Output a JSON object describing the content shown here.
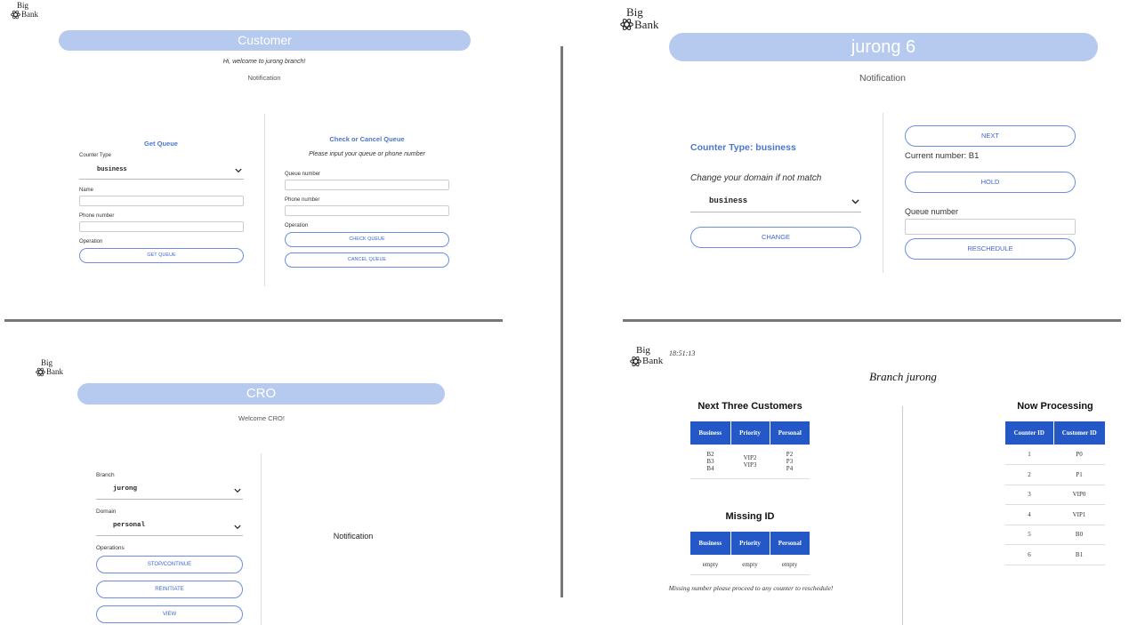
{
  "customer": {
    "logo": {
      "big": "Big",
      "bank": "Bank"
    },
    "banner_title": "Customer",
    "welcome": "Hi, welcome to jurong branch!",
    "notification": "Notification",
    "get_queue": {
      "title": "Get Queue",
      "counter_type_label": "Counter Type",
      "counter_type_value": "business",
      "name_label": "Name",
      "phone_label": "Phone number",
      "operation_label": "Operation",
      "button": "GET QUEUE"
    },
    "check_cancel": {
      "title": "Check or Cancel Queue",
      "subtitle": "Please input your queue or phone number",
      "queue_label": "Queue number",
      "phone_label": "Phone number",
      "operation_label": "Operation",
      "check_button": "CHECK QUEUE",
      "cancel_button": "CANCEL QUEUE"
    }
  },
  "counter": {
    "logo": {
      "big": "Big",
      "bank": "Bank"
    },
    "banner_title": "jurong 6",
    "notification": "Notification",
    "counter_type": "Counter Type: business",
    "change_domain": "Change your domain if not match",
    "domain_value": "business",
    "change_button": "CHANGE",
    "next_button": "NEXT",
    "current_number": "Current number: B1",
    "hold_button": "HOLD",
    "queue_label": "Queue number",
    "reschedule_button": "RESCHEDULE"
  },
  "cro": {
    "logo": {
      "big": "Big",
      "bank": "Bank"
    },
    "banner_title": "CRO",
    "welcome": "Welcome CRO!",
    "branch_label": "Branch",
    "branch_value": "jurong",
    "domain_label": "Domain",
    "domain_value": "personal",
    "operations_label": "Operations",
    "stop_button": "STOP/CONTINUE",
    "reinitiate_button": "REINITIATE",
    "view_button": "VIEW",
    "notification": "Notification"
  },
  "display": {
    "logo": {
      "big": "Big",
      "bank": "Bank"
    },
    "time": "18:51:13",
    "branch_title": "Branch jurong",
    "next_three_title": "Next Three Customers",
    "next_headers": [
      "Business",
      "Priority",
      "Personal"
    ],
    "next_row": {
      "business": [
        "B2",
        "B3",
        "B4"
      ],
      "priority": [
        "VIP2",
        "VIP3"
      ],
      "personal": [
        "P2",
        "P3",
        "P4"
      ]
    },
    "missing_title": "Missing ID",
    "missing_headers": [
      "Business",
      "Priority",
      "Personal"
    ],
    "missing_row": [
      "empty",
      "empty",
      "empty"
    ],
    "missing_note": "Missing number please proceed to any counter to reschedule!",
    "now_processing_title": "Now Processing",
    "processing_headers": [
      "Counter ID",
      "Customer ID"
    ],
    "processing_rows": [
      [
        "1",
        "P0"
      ],
      [
        "2",
        "P1"
      ],
      [
        "3",
        "VIP0"
      ],
      [
        "4",
        "VIP1"
      ],
      [
        "5",
        "B0"
      ],
      [
        "6",
        "B1"
      ]
    ]
  }
}
